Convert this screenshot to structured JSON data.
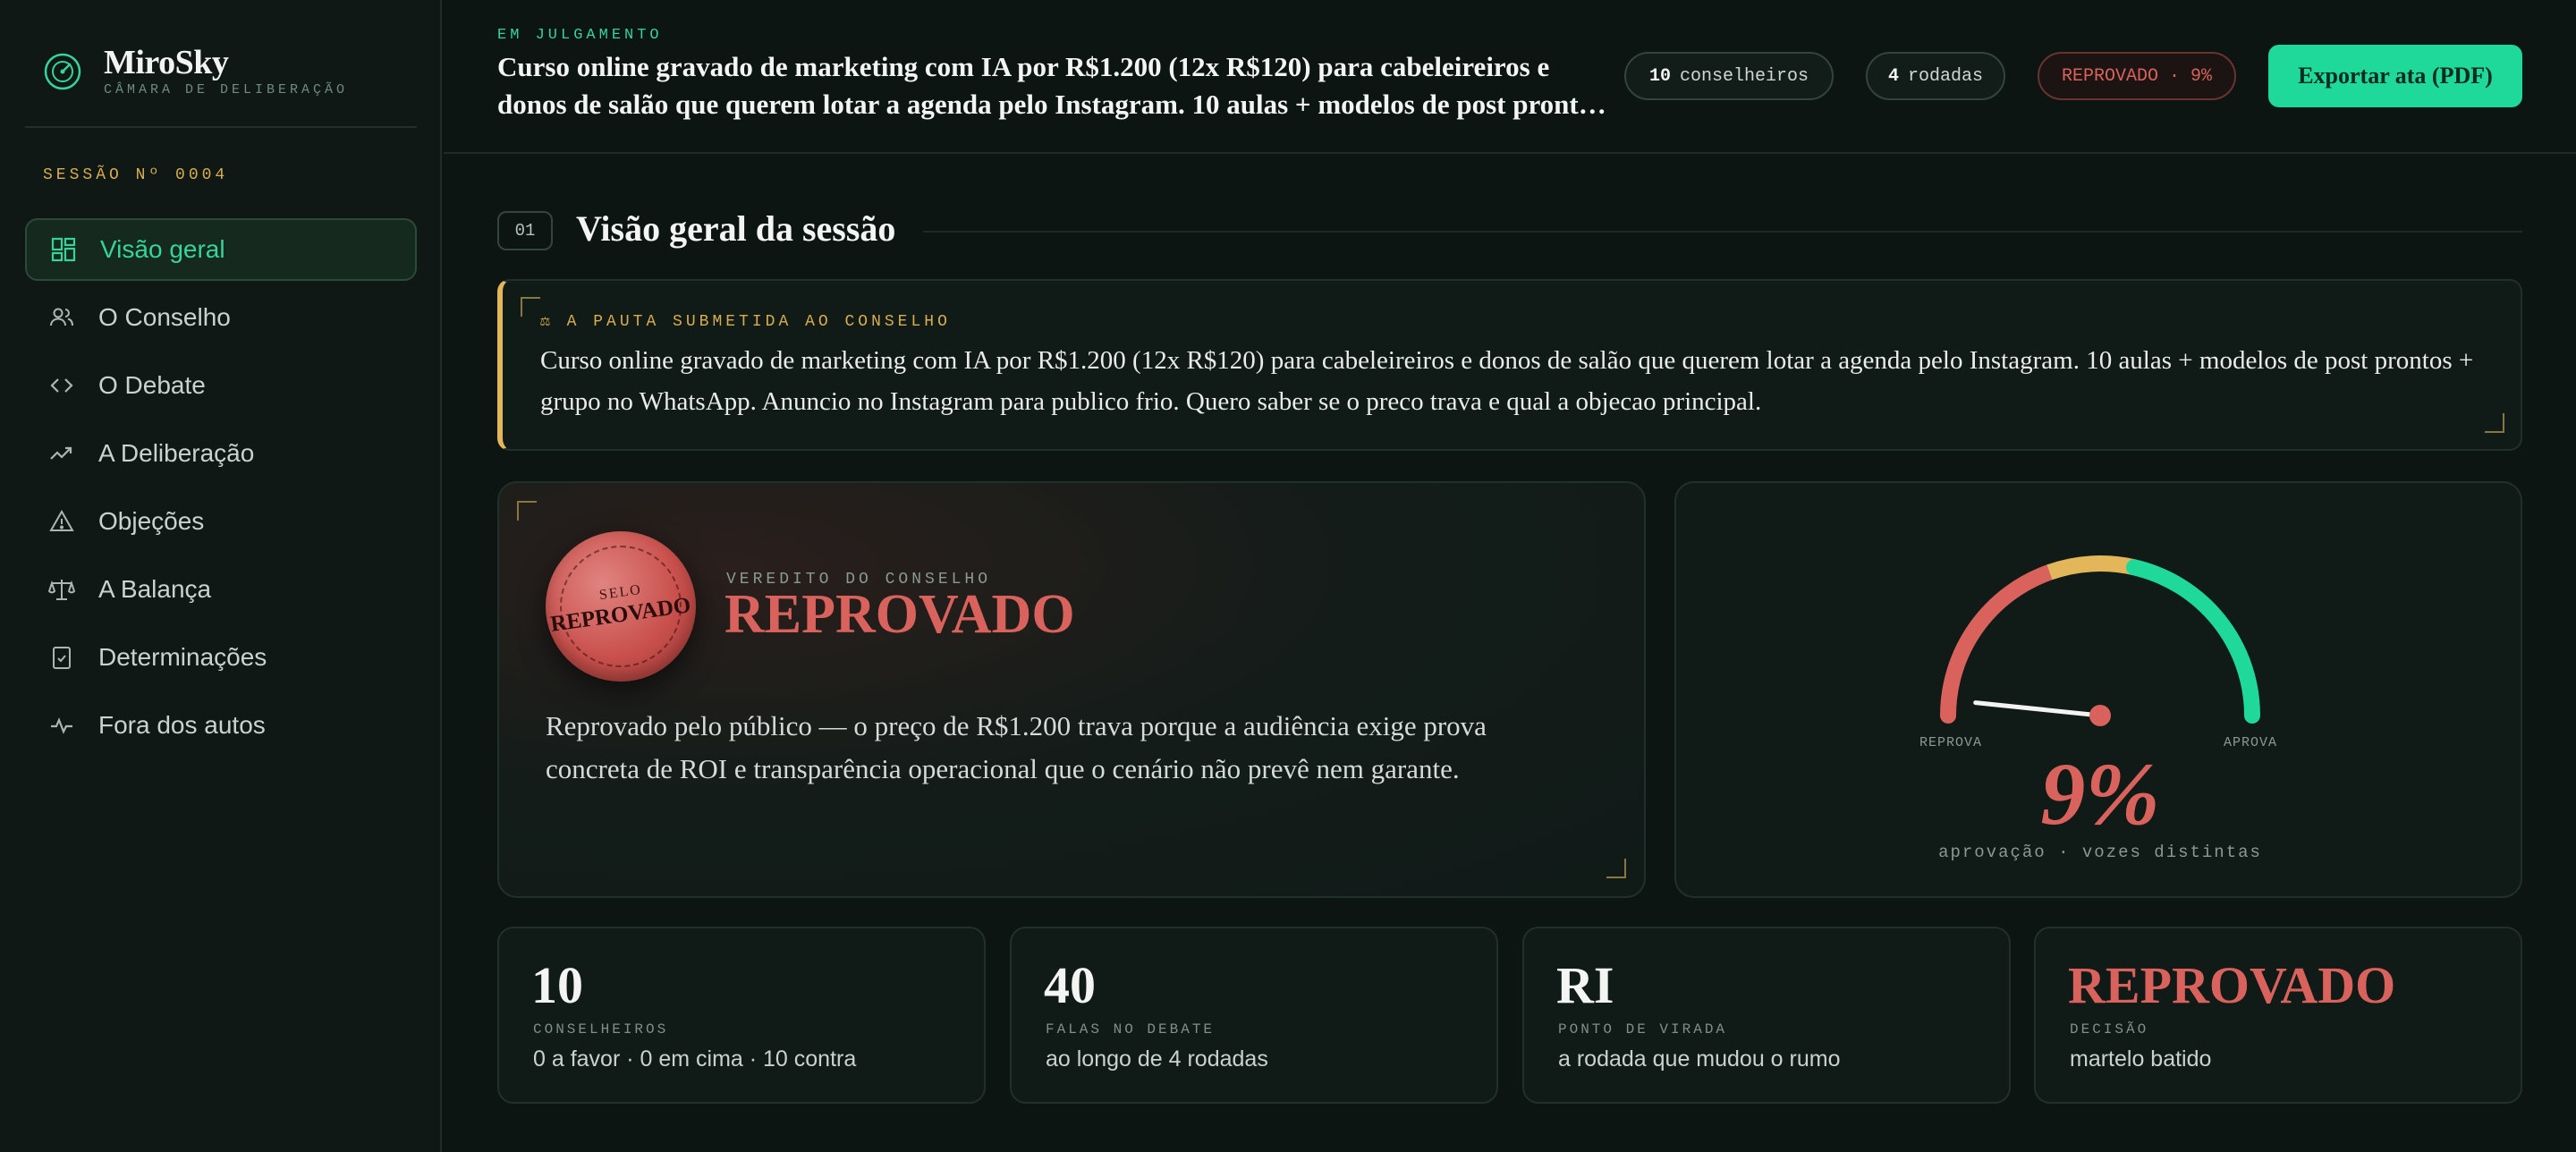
{
  "brand": {
    "name": "MiroSky",
    "subtitle": "CÂMARA DE DELIBERAÇÃO",
    "icon": "gauge-icon"
  },
  "sidebar": {
    "session_label": "SESSÃO Nº 0004",
    "items": [
      {
        "label": "Visão geral",
        "icon": "grid-icon",
        "active": true
      },
      {
        "label": "O Conselho",
        "icon": "users-icon"
      },
      {
        "label": "O Debate",
        "icon": "code-icon"
      },
      {
        "label": "A Deliberação",
        "icon": "trend-icon"
      },
      {
        "label": "Objeções",
        "icon": "warning-icon"
      },
      {
        "label": "A Balança",
        "icon": "scale-icon"
      },
      {
        "label": "Determinações",
        "icon": "clipboard-check-icon"
      },
      {
        "label": "Fora dos autos",
        "icon": "pulse-icon"
      }
    ]
  },
  "topbar": {
    "tag": "EM JULGAMENTO",
    "title": "Curso online gravado de marketing com IA por R$1.200 (12x R$120) para cabeleireiros e donos de salão que querem lotar a agenda pelo Instagram. 10 aulas + modelos de post prontos + grupo no WhatsApp.",
    "counselors_num": "10",
    "counselors_label": "conselheiros",
    "rounds_num": "4",
    "rounds_label": "rodadas",
    "status": "REPROVADO · 9%",
    "export_label": "Exportar ata (PDF)"
  },
  "section": {
    "number": "01",
    "title": "Visão geral da sessão"
  },
  "pauta": {
    "tag": "⚖ A PAUTA SUBMETIDA AO CONSELHO",
    "text": "Curso online gravado de marketing com IA por R$1.200 (12x R$120) para cabeleireiros e donos de salão que querem lotar a agenda pelo Instagram. 10 aulas + modelos de post prontos + grupo no WhatsApp. Anuncio no Instagram para publico frio. Quero saber se o preco trava e qual a objecao principal."
  },
  "verdict": {
    "seal_top": "SELO",
    "seal_word": "REPROVADO",
    "tag": "VEREDITO DO CONSELHO",
    "word": "REPROVADO",
    "text": "Reprovado pelo público — o preço de R$1.200 trava porque a audiência exige prova concreta de ROI e transparência operacional que o cenário não prevê nem garante."
  },
  "gauge": {
    "value": 9,
    "value_text": "9%",
    "left_label": "REPROVA",
    "right_label": "APROVA",
    "subtitle": "aprovação · vozes distintas",
    "colors": {
      "red": "#d9625d",
      "yellow": "#e2b659",
      "green": "#1ed99a"
    }
  },
  "stats": [
    {
      "value": "10",
      "label": "CONSELHEIROS",
      "desc": "0 a favor · 0 em cima · 10 contra"
    },
    {
      "value": "40",
      "label": "FALAS NO DEBATE",
      "desc": "ao longo de 4 rodadas"
    },
    {
      "value": "RI",
      "label": "PONTO DE VIRADA",
      "desc": "a rodada que mudou o rumo"
    },
    {
      "value": "REPROVADO",
      "label": "DECISÃO",
      "desc": "martelo batido"
    }
  ],
  "colors": {
    "accent": "#36d39b",
    "gold": "#d9ad4f",
    "danger": "#d9625d",
    "background": "#0c1512"
  }
}
